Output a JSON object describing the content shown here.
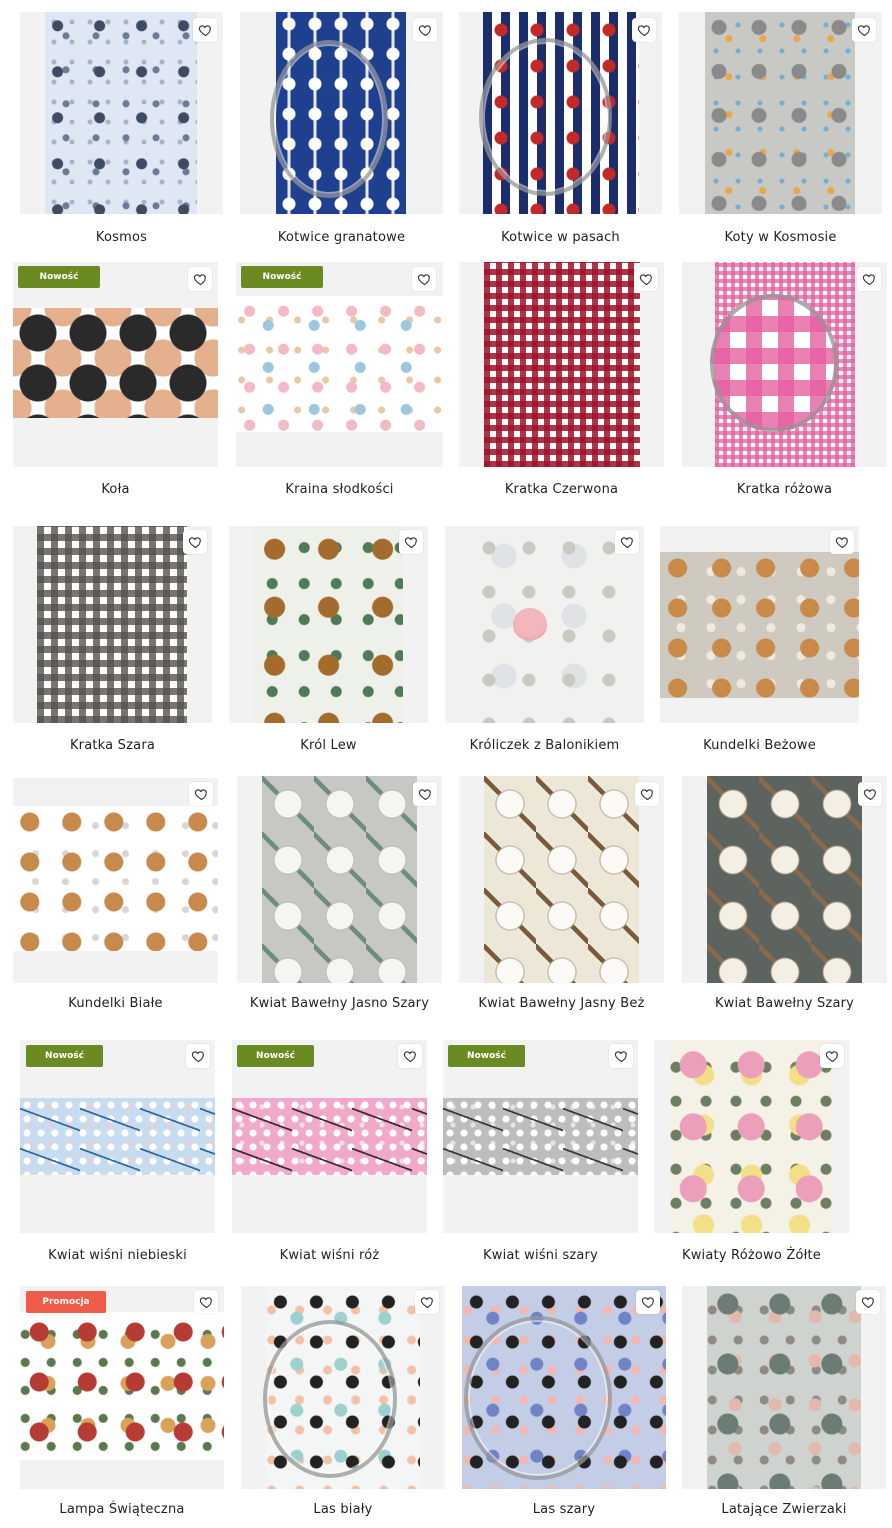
{
  "colors": {
    "badge_new": "#6a8b22",
    "badge_promo": "#f05a48",
    "heart": "#333333"
  },
  "icons": {
    "favorite": "heart-outline-icon"
  },
  "products": [
    {
      "name": "Kosmos",
      "badge": null,
      "pattern": "space"
    },
    {
      "name": "Kotwice granatowe",
      "badge": null,
      "pattern": "anchors-navy"
    },
    {
      "name": "Kotwice w pasach",
      "badge": null,
      "pattern": "anchors-stripes"
    },
    {
      "name": "Koty w Kosmosie",
      "badge": null,
      "pattern": "cats-space"
    },
    {
      "name": "Koła",
      "badge": "Nowość",
      "pattern": "circles"
    },
    {
      "name": "Kraina słodkości",
      "badge": "Nowość",
      "pattern": "sweets"
    },
    {
      "name": "Kratka Czerwona",
      "badge": null,
      "pattern": "check-red"
    },
    {
      "name": "Kratka różowa",
      "badge": null,
      "pattern": "check-pink"
    },
    {
      "name": "Kratka Szara",
      "badge": null,
      "pattern": "check-grey"
    },
    {
      "name": "Król Lew",
      "badge": null,
      "pattern": "lion-king"
    },
    {
      "name": "Króliczek z Balonikiem",
      "badge": null,
      "pattern": "bunny-balloon"
    },
    {
      "name": "Kundelki Beżowe",
      "badge": null,
      "pattern": "puppies-beige"
    },
    {
      "name": "Kundelki Białe",
      "badge": null,
      "pattern": "puppies-white"
    },
    {
      "name": "Kwiat Bawełny Jasno Szary",
      "badge": null,
      "pattern": "cotton-lightgrey"
    },
    {
      "name": "Kwiat Bawełny Jasny Beż",
      "badge": null,
      "pattern": "cotton-beige"
    },
    {
      "name": "Kwiat Bawełny Szary",
      "badge": null,
      "pattern": "cotton-grey"
    },
    {
      "name": "Kwiat wiśni niebieski",
      "badge": "Nowość",
      "pattern": "cherry-blue"
    },
    {
      "name": "Kwiat wiśni róż",
      "badge": "Nowość",
      "pattern": "cherry-pink"
    },
    {
      "name": "Kwiat wiśni szary",
      "badge": "Nowość",
      "pattern": "cherry-grey"
    },
    {
      "name": "Kwiaty Różowo Żółte",
      "badge": null,
      "pattern": "roses"
    },
    {
      "name": "Lampa Świąteczna",
      "badge": "Promocja",
      "pattern": "christmas"
    },
    {
      "name": "Las biały",
      "badge": null,
      "pattern": "forest-white"
    },
    {
      "name": "Las szary",
      "badge": null,
      "pattern": "forest-grey"
    },
    {
      "name": "Latające Zwierzaki",
      "badge": null,
      "pattern": "flying-animals"
    }
  ]
}
